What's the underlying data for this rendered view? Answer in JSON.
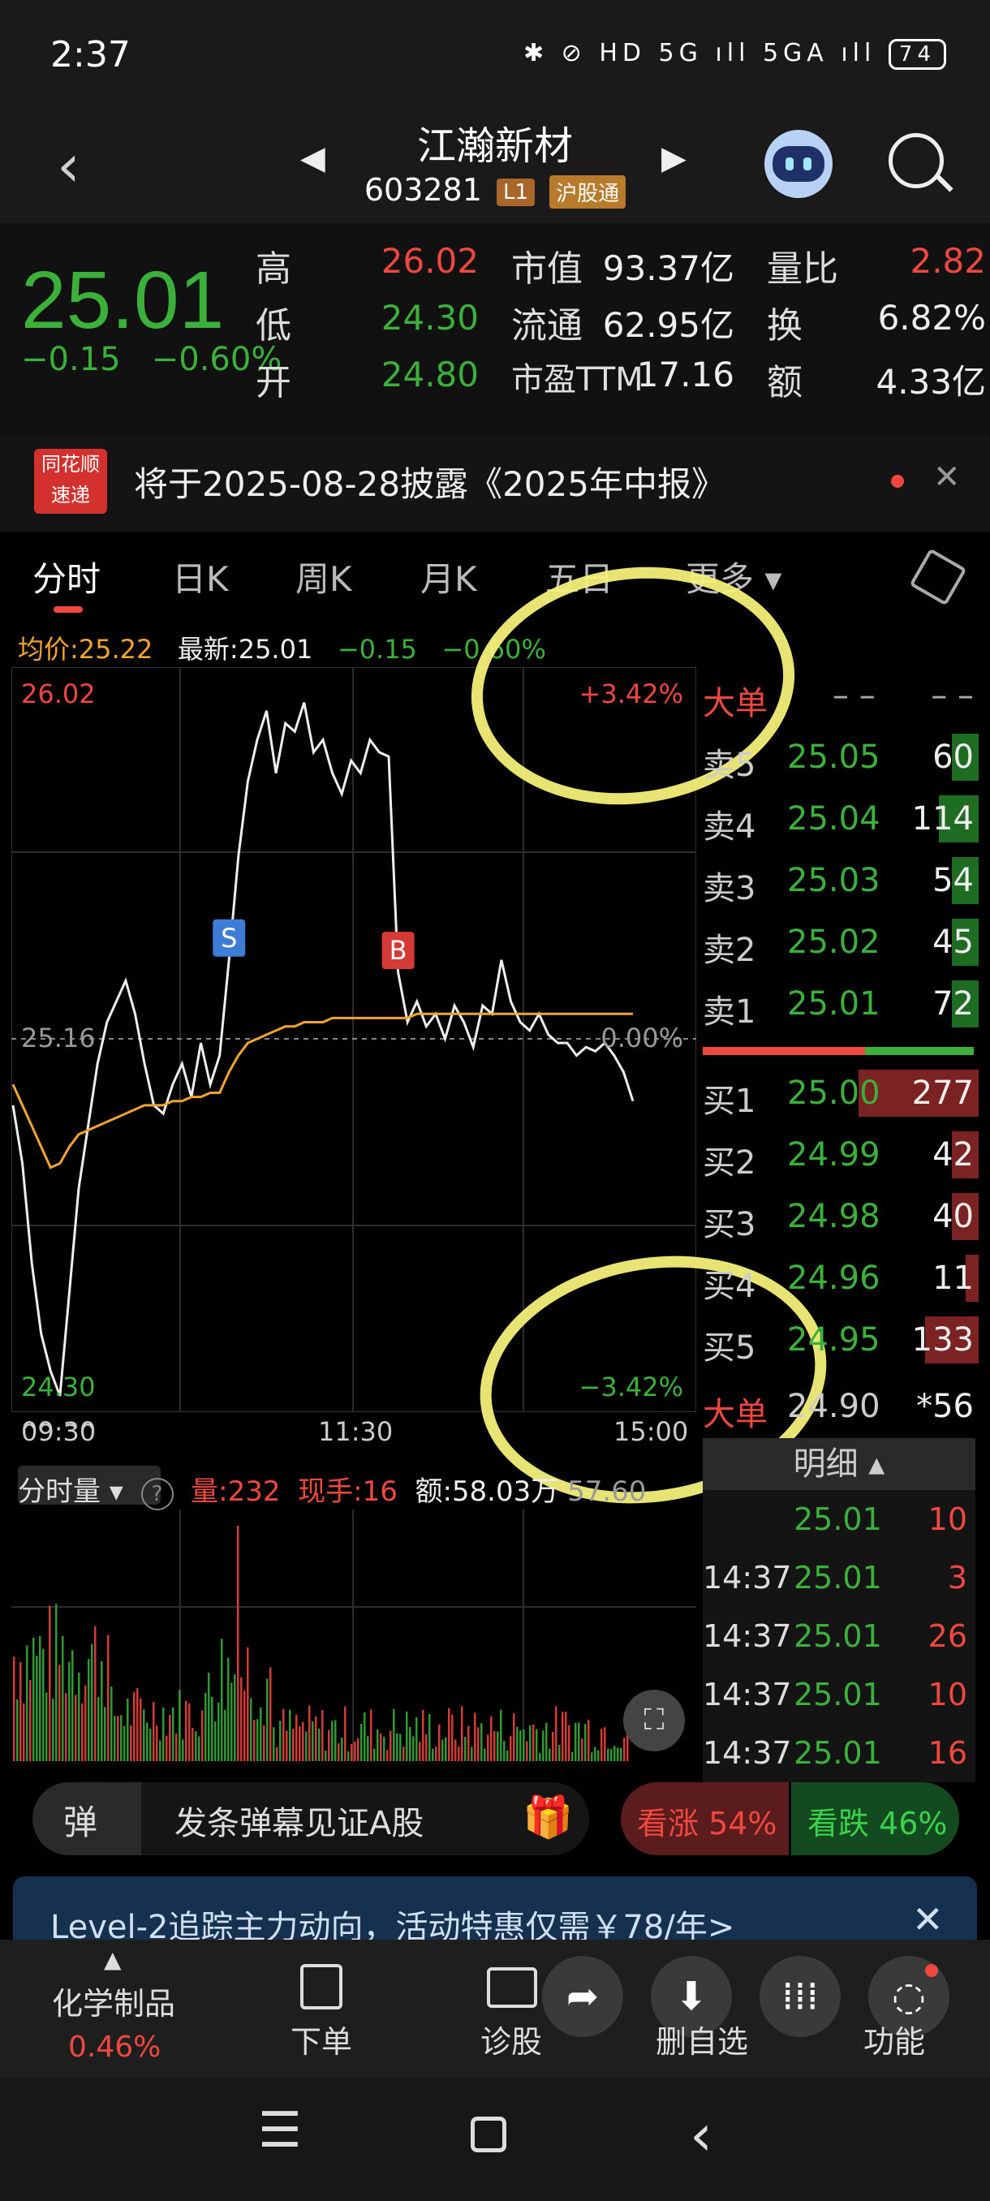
{
  "status_bar": {
    "time": "2:37",
    "icons": "✱ ⊘ HD 5G ıll 5GA ıll",
    "battery": "74"
  },
  "header": {
    "stock_name": "江瀚新材",
    "code": "603281",
    "badge_level": "L1",
    "badge_market": "沪股通"
  },
  "quote": {
    "price": "25.01",
    "change": "−0.15",
    "change_pct": "−0.60%",
    "stats": [
      {
        "label": "高",
        "value": "26.02",
        "color": "red"
      },
      {
        "label": "低",
        "value": "24.30",
        "color": "green"
      },
      {
        "label": "开",
        "value": "24.80",
        "color": "green"
      },
      {
        "label": "市值",
        "value": "93.37亿",
        "color": "white"
      },
      {
        "label": "流通",
        "value": "62.95亿",
        "color": "white"
      },
      {
        "label": "市盈TTM",
        "value": "17.16",
        "color": "white"
      },
      {
        "label": "量比",
        "value": "2.82",
        "color": "red"
      },
      {
        "label": "换",
        "value": "6.82%",
        "color": "white"
      },
      {
        "label": "额",
        "value": "4.33亿",
        "color": "white"
      }
    ]
  },
  "announcement": {
    "logo_top": "同花顺",
    "logo_bottom": "速递",
    "text": "将于2025-08-28披露《2025年中报》"
  },
  "tabs": [
    "分时",
    "日K",
    "周K",
    "月K",
    "五日",
    "更多 ▾"
  ],
  "info_row": {
    "avg": "均价:25.22",
    "latest": "最新:25.01",
    "change": "−0.15",
    "change_pct": "−0.60%"
  },
  "chart_data": {
    "type": "line",
    "y_max_label": "26.02",
    "y_min_label": "24.30",
    "y_mid_label": "25.16",
    "pct_top": "+3.42%",
    "pct_mid": "0.00%",
    "pct_bottom": "−3.42%",
    "x_labels": [
      "09:30",
      "11:30",
      "15:00"
    ],
    "ylim": [
      24.3,
      26.02
    ],
    "prev_close": 25.16,
    "series": [
      {
        "name": "最新",
        "values": [
          25.0,
          24.86,
          24.62,
          24.45,
          24.36,
          24.3,
          24.55,
          24.8,
          24.95,
          25.1,
          25.2,
          25.25,
          25.3,
          25.22,
          25.1,
          25.0,
          24.98,
          25.05,
          25.1,
          25.02,
          25.15,
          25.05,
          25.12,
          25.35,
          25.6,
          25.78,
          25.88,
          25.95,
          25.8,
          25.92,
          25.9,
          25.97,
          25.85,
          25.88,
          25.8,
          25.75,
          25.83,
          25.8,
          25.88,
          25.85,
          25.84,
          25.32,
          25.2,
          25.25,
          25.19,
          25.22,
          25.16,
          25.24,
          25.2,
          25.14,
          25.24,
          25.22,
          25.35,
          25.25,
          25.2,
          25.18,
          25.22,
          25.17,
          25.15,
          25.15,
          25.12,
          25.14,
          25.13,
          25.15,
          25.12,
          25.08,
          25.01
        ],
        "color": "#eeeeee"
      },
      {
        "name": "均价",
        "values": [
          25.05,
          25.0,
          24.95,
          24.9,
          24.85,
          24.86,
          24.9,
          24.93,
          24.94,
          24.95,
          24.96,
          24.97,
          24.98,
          24.99,
          25.0,
          25.0,
          25.0,
          25.01,
          25.01,
          25.02,
          25.02,
          25.03,
          25.03,
          25.08,
          25.12,
          25.15,
          25.16,
          25.17,
          25.18,
          25.19,
          25.19,
          25.2,
          25.2,
          25.2,
          25.21,
          25.21,
          25.21,
          25.21,
          25.21,
          25.21,
          25.21,
          25.21,
          25.21,
          25.22,
          25.22,
          25.22,
          25.22,
          25.22,
          25.22,
          25.22,
          25.22,
          25.22,
          25.22,
          25.22,
          25.22,
          25.22,
          25.22,
          25.22,
          25.22,
          25.22,
          25.22,
          25.22,
          25.22,
          25.22,
          25.22,
          25.22,
          25.22
        ],
        "color": "#f2a52c"
      }
    ],
    "markers": [
      {
        "label": "S"
      },
      {
        "label": "B"
      }
    ]
  },
  "order_book": {
    "header": {
      "label": "大单",
      "price": "– –",
      "vol": "– –"
    },
    "sells": [
      {
        "label": "卖5",
        "price": "25.05",
        "vol": "60",
        "bar": 0.1
      },
      {
        "label": "卖4",
        "price": "25.04",
        "vol": "114",
        "bar": 0.15
      },
      {
        "label": "卖3",
        "price": "25.03",
        "vol": "54",
        "bar": 0.1
      },
      {
        "label": "卖2",
        "price": "25.02",
        "vol": "45",
        "bar": 0.1
      },
      {
        "label": "卖1",
        "price": "25.01",
        "vol": "72",
        "bar": 0.1
      }
    ],
    "buys": [
      {
        "label": "买1",
        "price": "25.00",
        "vol": "277",
        "bar": 0.45
      },
      {
        "label": "买2",
        "price": "24.99",
        "vol": "42",
        "bar": 0.1
      },
      {
        "label": "买3",
        "price": "24.98",
        "vol": "40",
        "bar": 0.1
      },
      {
        "label": "买4",
        "price": "24.96",
        "vol": "11",
        "bar": 0.05
      },
      {
        "label": "买5",
        "price": "24.95",
        "vol": "133",
        "bar": 0.2
      }
    ],
    "big_order": {
      "label": "大单",
      "price": "24.90",
      "vol": "*56"
    },
    "detail_label": "明细 ▴",
    "ticks": [
      {
        "time": "",
        "price": "25.01",
        "vol": "10"
      },
      {
        "time": "14:37",
        "price": "25.01",
        "vol": "3"
      },
      {
        "time": "14:37",
        "price": "25.01",
        "vol": "26"
      },
      {
        "time": "14:37",
        "price": "25.01",
        "vol": "10"
      },
      {
        "time": "14:37",
        "price": "25.01",
        "vol": "16"
      }
    ]
  },
  "volume": {
    "select": "分时量 ▾",
    "help": "?",
    "qty": "量:232",
    "now": "现手:16",
    "amount": "额:58.03万",
    "extra": "57.60"
  },
  "danmaku": {
    "btn": "弹",
    "placeholder": "发条弹幕见证A股",
    "rise": "看涨 54%",
    "fall": "看跌 46%"
  },
  "promo": {
    "text": "Level-2追踪主力动向，活动特惠仅需￥78/年>"
  },
  "toolbar": {
    "sector": "化学制品",
    "sector_pct": "0.46%",
    "order": "下单",
    "diagnose": "诊股",
    "del_watch": "删自选",
    "func": "功能"
  }
}
